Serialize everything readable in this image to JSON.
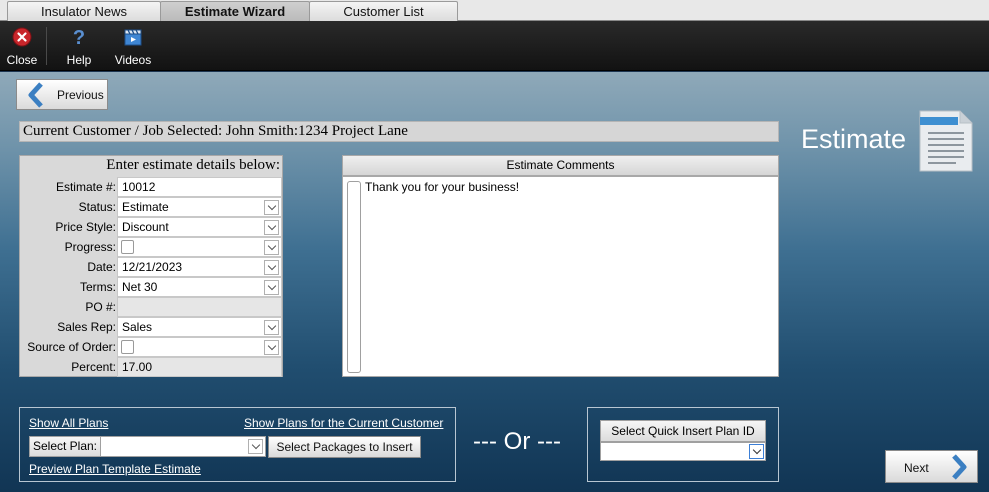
{
  "tabs": [
    {
      "label": "Insulator News",
      "active": false
    },
    {
      "label": "Estimate Wizard",
      "active": true
    },
    {
      "label": "Customer List",
      "active": false
    }
  ],
  "toolbar": {
    "close_label": "Close",
    "help_label": "Help",
    "videos_label": "Videos",
    "close_icon": "close-circle-icon",
    "help_icon": "question-icon",
    "videos_icon": "clapperboard-icon"
  },
  "nav": {
    "previous_label": "Previous",
    "next_label": "Next"
  },
  "customer_bar": "Current Customer / Job Selected: John Smith:1234 Project Lane",
  "page_title": "Estimate",
  "details": {
    "header": "Enter estimate details below:",
    "fields": [
      {
        "label": "Estimate #:",
        "value": "10012"
      },
      {
        "label": "Status:",
        "value": "Estimate"
      },
      {
        "label": "Price Style:",
        "value": "Discount"
      },
      {
        "label": "Progress:",
        "value": ""
      },
      {
        "label": "Date:",
        "value": "12/21/2023"
      },
      {
        "label": "Terms:",
        "value": "Net 30"
      },
      {
        "label": "PO #:",
        "value": ""
      },
      {
        "label": "Sales Rep:",
        "value": "Sales"
      },
      {
        "label": "Source of Order:",
        "value": ""
      },
      {
        "label": "Percent:",
        "value": "17.00"
      }
    ]
  },
  "comments": {
    "header": "Estimate Comments",
    "text": "Thank you for your business!"
  },
  "plans": {
    "show_all": "Show All Plans",
    "show_customer": "Show Plans for the Current Customer",
    "select_plan_label": "Select Plan:",
    "select_plan_value": "",
    "select_packages": "Select Packages to Insert",
    "preview_link": "Preview Plan Template Estimate"
  },
  "or_text": "--- Or ---",
  "quick_insert": {
    "label": "Select Quick Insert Plan ID",
    "value": ""
  },
  "colors": {
    "accent_blue": "#3b7fc2",
    "close_red": "#c8262b"
  }
}
